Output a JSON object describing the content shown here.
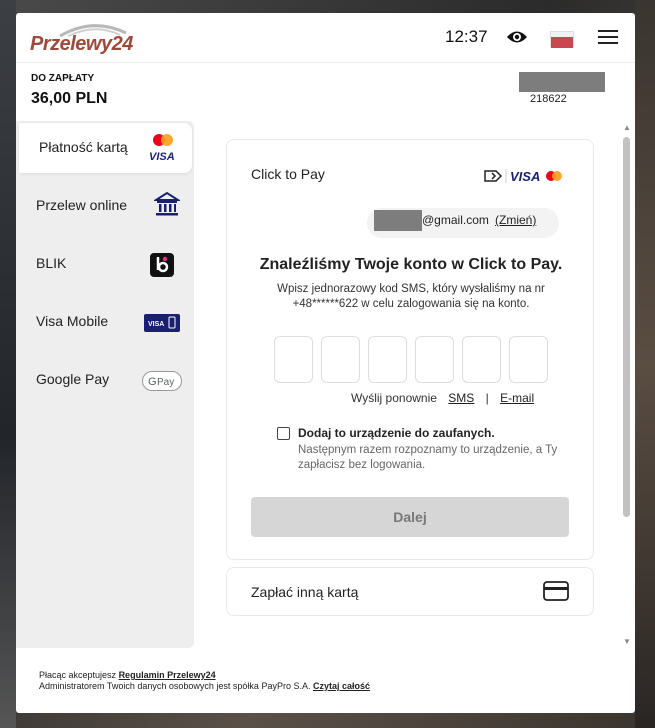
{
  "header": {
    "logo_text": "Przelewy24",
    "time": "12:37",
    "eye_icon": "eye-icon",
    "flag_icon": "poland-flag-icon",
    "menu_icon": "hamburger-menu-icon"
  },
  "summary": {
    "amount_label": "DO ZAPŁATY",
    "amount": "36,00 PLN",
    "order_id": "218622"
  },
  "sidebar": {
    "items": [
      {
        "label": "Płatność kartą",
        "icon": "mastercard-visa-icon",
        "active": true
      },
      {
        "label": "Przelew online",
        "icon": "bank-icon",
        "active": false
      },
      {
        "label": "BLIK",
        "icon": "blik-icon",
        "active": false
      },
      {
        "label": "Visa Mobile",
        "icon": "visa-mobile-icon",
        "active": false
      },
      {
        "label": "Google Pay",
        "icon": "google-pay-icon",
        "active": false
      }
    ]
  },
  "click_to_pay": {
    "title": "Click to Pay",
    "email": "@gmail.com",
    "change_link": "(Zmień)",
    "found_title": "Znaleźliśmy Twoje konto w Click to Pay.",
    "found_desc": "Wpisz jednorazowy kod SMS, który wysłaliśmy na nr +48******622 w celu zalogowania się na konto.",
    "otp_count": 6,
    "resend_label": "Wyślij ponownie",
    "resend_sms": "SMS",
    "resend_sep": "|",
    "resend_email": "E-mail",
    "trusted_label": "Dodaj to urządzenie do zaufanych.",
    "trusted_desc": "Następnym razem rozpoznamy to urządzenie, a Ty zapłacisz bez logowania.",
    "submit_label": "Dalej"
  },
  "other_card": {
    "label": "Zapłać inną kartą",
    "icon": "credit-card-icon"
  },
  "footer": {
    "line1_prefix": "Płacąc akceptujesz",
    "line1_link": "Regulamin Przelewy24",
    "line2_prefix": "Administratorem Twoich danych osobowych jest spółka PayPro S.A.",
    "line2_link": "Czytaj całość"
  },
  "colors": {
    "brand": "#9c4a3c",
    "visa_blue": "#1a1f71",
    "mc_red": "#eb001b",
    "mc_orange": "#f79e1b"
  }
}
